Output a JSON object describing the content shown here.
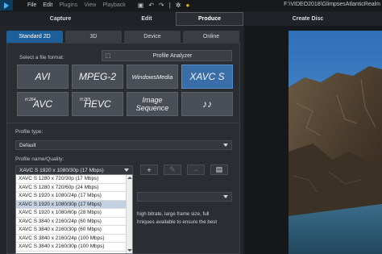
{
  "menubar": {
    "items": [
      "File",
      "Edit",
      "Plugins",
      "View",
      "Playback"
    ],
    "title_path": "F:\\VIDEO2018\\GlimpsesAtlanticRealm"
  },
  "main_tabs": {
    "capture": "Capture",
    "edit": "Edit",
    "produce": "Produce",
    "disc": "Create Disc"
  },
  "sub_tabs": [
    "Standard 2D",
    "3D",
    "Device",
    "Online"
  ],
  "format_section": {
    "label": "Select a file format:",
    "analyzer_label": "Profile Analyzer",
    "formats": [
      {
        "label": "AVI",
        "sup": ""
      },
      {
        "label": "MPEG-2",
        "sup": ""
      },
      {
        "label": "WindowsMedia",
        "sup": ""
      },
      {
        "label": "XAVC S",
        "sup": ""
      },
      {
        "label": "AVC",
        "sup": "H.264"
      },
      {
        "label": "HEVC",
        "sup": "H.265"
      },
      {
        "label": "Image Sequence",
        "sup": ""
      },
      {
        "label": "♪♪",
        "sup": ""
      }
    ]
  },
  "profile": {
    "type_label": "Profile type:",
    "type_value": "Default",
    "name_label": "Profile name/Quality:",
    "name_value": "XAVC S 1920 x 1080/30p (17 Mbps)",
    "buttons": [
      "+",
      "✎",
      "−",
      "▤"
    ]
  },
  "dropdown_options": [
    "XAVC S 1280 x 720/30p (17 Mbps)",
    "XAVC S 1280 x 720/60p (24 Mbps)",
    "XAVC S 1920 x 1080/24p (17 Mbps)",
    "XAVC S 1920 x 1080/30p (17 Mbps)",
    "XAVC S 1920 x 1080/60p (28 Mbps)",
    "XAVC S 3840 x 2160/24p (60 Mbps)",
    "XAVC S 3840 x 2160/30p (60 Mbps)",
    "XAVC S 3840 x 2160/24p (100 Mbps)",
    "XAVC S 3840 x 2160/30p (100 Mbps)"
  ],
  "description": {
    "line1": "high bitrate, large frame size, full",
    "line2": "hniques available to ensure the best"
  }
}
